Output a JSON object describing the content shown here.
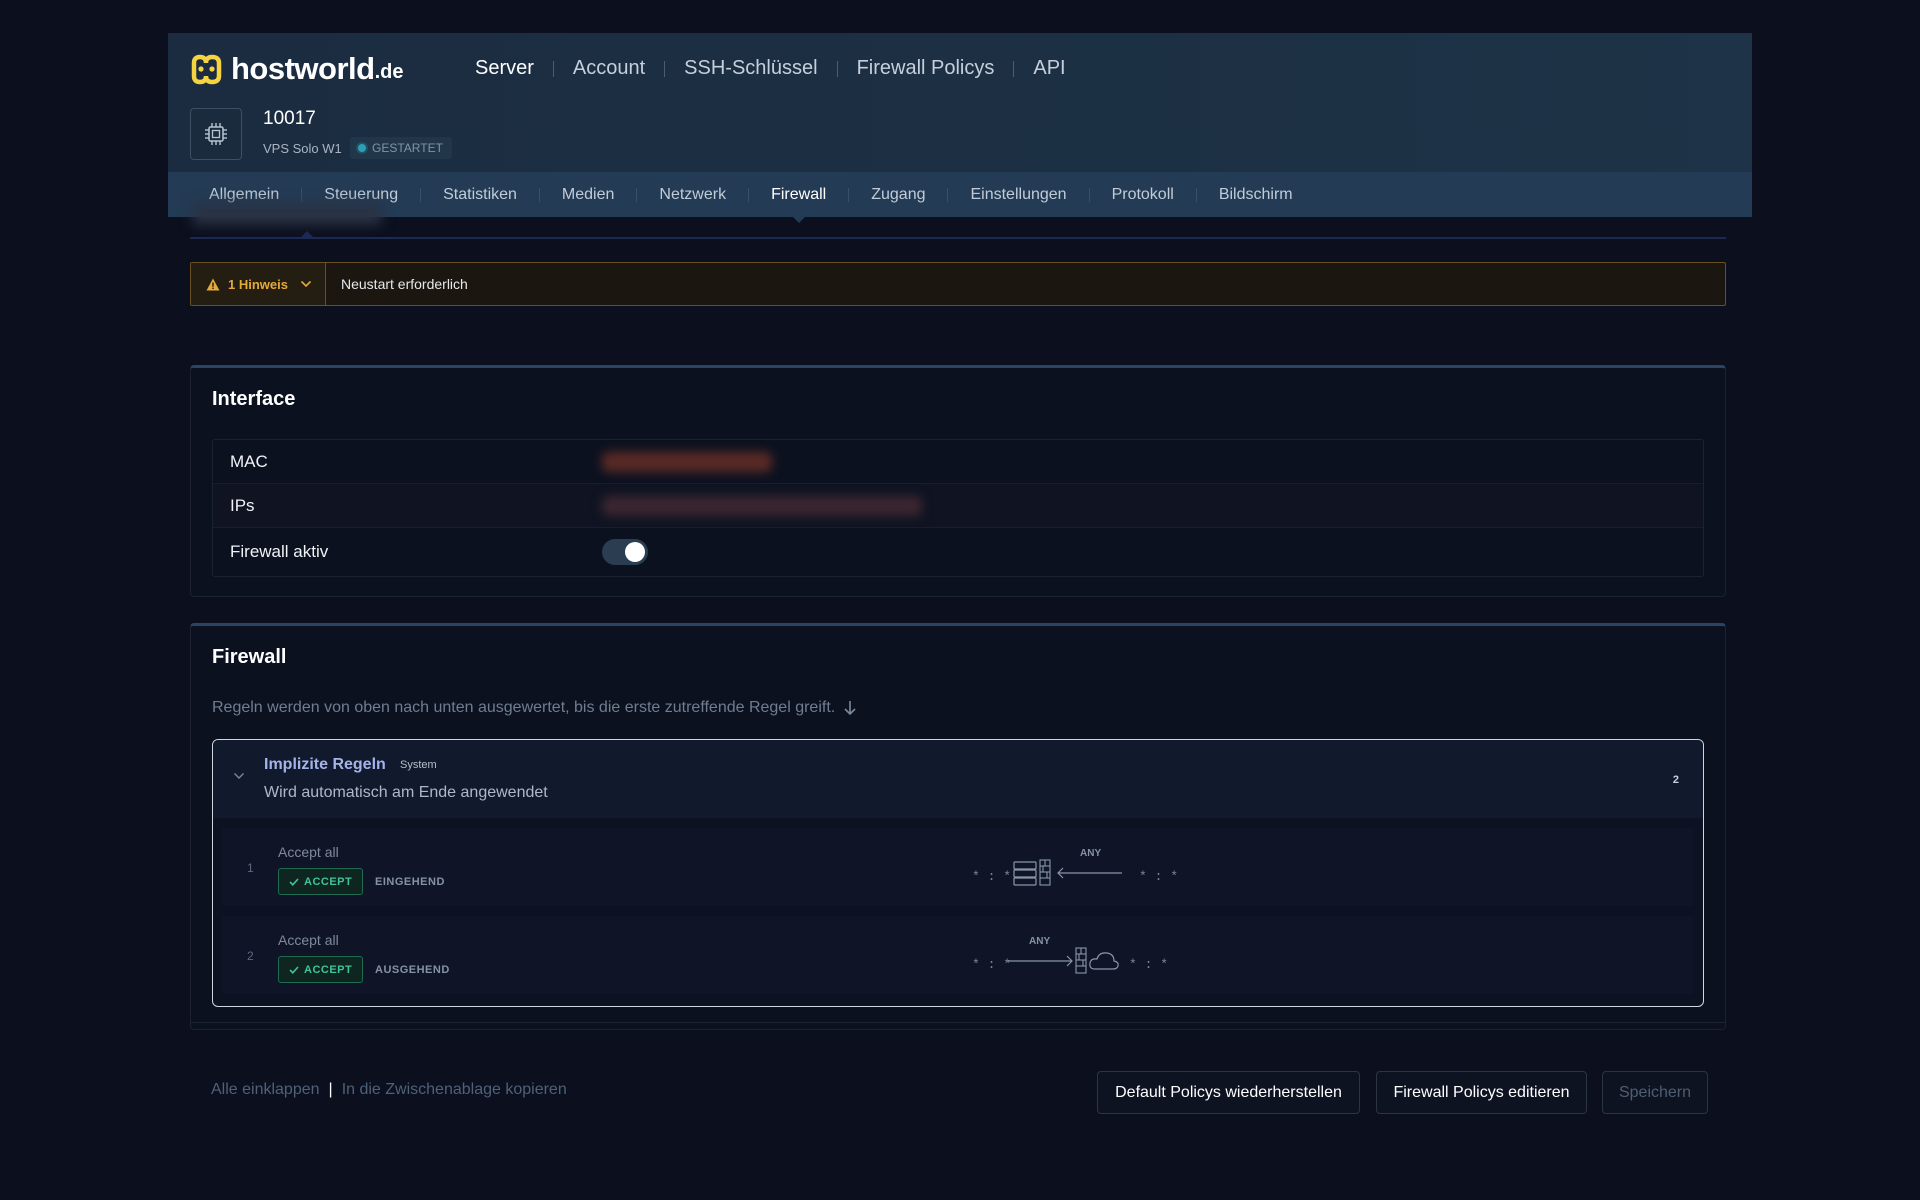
{
  "brand": {
    "name": "hostworld",
    "tld": ".de",
    "accent": "#f5d442"
  },
  "topnav": [
    "Server",
    "Account",
    "SSH-Schlüssel",
    "Firewall Policys",
    "API"
  ],
  "server": {
    "id": "10017",
    "plan": "VPS Solo W1",
    "status": "GESTARTET",
    "icon": "cpu-chip-icon"
  },
  "tabs": [
    "Allgemein",
    "Steuerung",
    "Statistiken",
    "Medien",
    "Netzwerk",
    "Firewall",
    "Zugang",
    "Einstellungen",
    "Protokoll",
    "Bildschirm"
  ],
  "active_tab": "Firewall",
  "alert": {
    "count": "1 Hinweis",
    "message": "Neustart erforderlich",
    "icon": "warning-triangle-icon",
    "color": "#e5a93a"
  },
  "interface": {
    "title": "Interface",
    "rows": [
      {
        "label": "MAC"
      },
      {
        "label": "IPs"
      },
      {
        "label": "Firewall aktiv",
        "toggle": true
      }
    ]
  },
  "firewall": {
    "title": "Firewall",
    "description": "Regeln werden von oben nach unten ausgewertet, bis die erste zutreffende Regel greift.",
    "group": {
      "title": "Implizite Regeln",
      "tag": "System",
      "subtitle": "Wird automatisch am Ende angewendet",
      "count": "2"
    },
    "rules": [
      {
        "num": "1",
        "name": "Accept all",
        "action": "ACCEPT",
        "direction": "EINGEHEND",
        "src": "* : *",
        "dst": "* : *",
        "proto": "ANY"
      },
      {
        "num": "2",
        "name": "Accept all",
        "action": "ACCEPT",
        "direction": "AUSGEHEND",
        "src": "* : *",
        "dst": "* : *",
        "proto": "ANY"
      }
    ]
  },
  "footer": {
    "collapse": "Alle einklappen",
    "separator": "|",
    "copy": "In die Zwischenablage kopieren",
    "restore": "Default Policys wiederherstellen",
    "edit": "Firewall Policys editieren",
    "save": "Speichern"
  }
}
